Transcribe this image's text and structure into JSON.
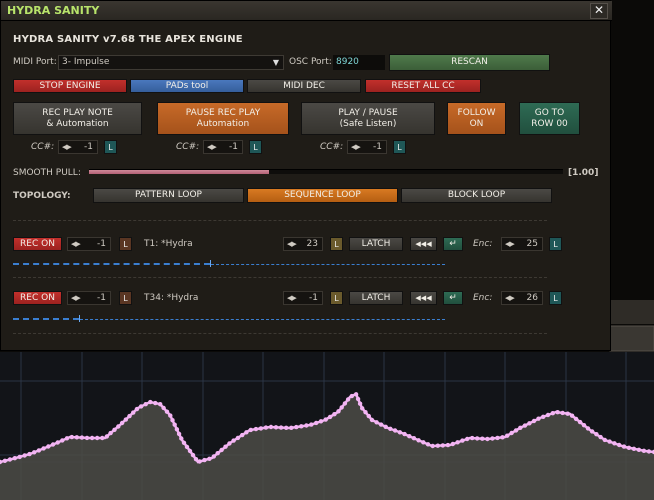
{
  "window": {
    "title": "HYDRA SANITY",
    "close_label": "✕"
  },
  "heading": "HYDRA SANITY v7.68 THE APEX ENGINE",
  "midi": {
    "label": "MIDI Port:",
    "selected": "3- Impulse"
  },
  "osc": {
    "label": "OSC Port:",
    "value": "8920"
  },
  "buttons": {
    "rescan": "RESCAN",
    "stop_engine": "STOP ENGINE",
    "pads_tool": "PADs tool",
    "midi_dec": "MIDI DEC",
    "reset_all_cc": "RESET ALL CC",
    "rec_play_note": [
      "REC PLAY NOTE",
      "& Automation"
    ],
    "pause_rec_play": [
      "PAUSE REC PLAY",
      "Automation"
    ],
    "play_pause": [
      "PLAY / PAUSE",
      "(Safe Listen)"
    ],
    "follow_on": [
      "FOLLOW",
      "ON"
    ],
    "go_to_row": [
      "GO TO",
      "ROW 00"
    ]
  },
  "cc_controls": [
    {
      "label": "CC#:",
      "value": "-1",
      "badge": "L"
    },
    {
      "label": "CC#:",
      "value": "-1",
      "badge": "L"
    },
    {
      "label": "CC#:",
      "value": "-1",
      "badge": "L"
    }
  ],
  "smooth_pull": {
    "label": "SMOOTH PULL:",
    "value_text": "[1.00]",
    "level": 0.38
  },
  "topology": {
    "label": "TOPOLOGY:",
    "options": [
      "PATTERN LOOP",
      "SEQUENCE LOOP",
      "BLOCK LOOP"
    ],
    "selected": "SEQUENCE LOOP"
  },
  "tracks": [
    {
      "rec_label": "REC ON",
      "value": "-1",
      "badge": "L",
      "name": "T1: *Hydra",
      "param": "23",
      "param_badge": "L",
      "latch": "LATCH",
      "rewind": "◀◀◀",
      "return": "↵",
      "enc_label": "Enc:",
      "enc": "25",
      "enc_badge": "L"
    },
    {
      "rec_label": "REC ON",
      "value": "-1",
      "badge": "L",
      "name": "T34: *Hydra",
      "param": "-1",
      "param_badge": "L",
      "latch": "LATCH",
      "rewind": "◀◀◀",
      "return": "↵",
      "enc_label": "Enc:",
      "enc": "26",
      "enc_badge": "L"
    }
  ],
  "colors": {
    "title": "#b8e46b",
    "accent_orange": "#c76a28",
    "stop_red": "#c2302c",
    "track_blue": "#3b7fd0",
    "envelope_pink": "#f3b4f3"
  },
  "icons": [
    "close-icon",
    "chevron-down-icon",
    "stepper-arrows-icon",
    "rewind-icon",
    "return-icon"
  ]
}
